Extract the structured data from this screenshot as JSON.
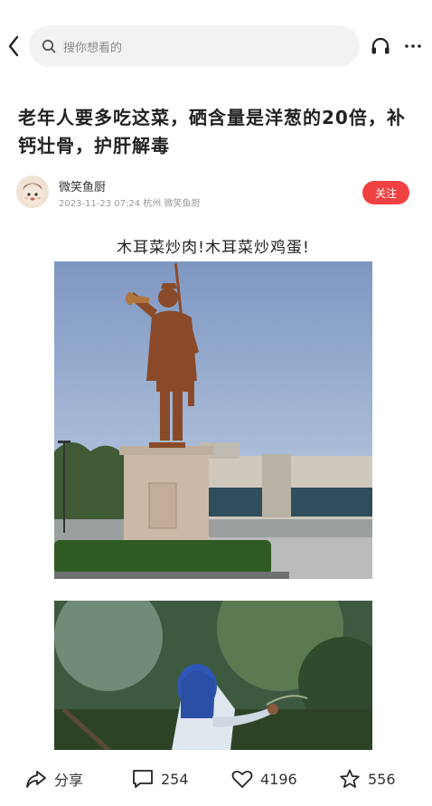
{
  "header": {
    "search_placeholder": "搜你想看的"
  },
  "article": {
    "title": "老年人要多吃这菜，硒含量是洋葱的20倍，补钙壮骨，护肝解毒",
    "author": {
      "name": "微笑鱼厨",
      "meta": "2023-11-23 07:24 杭州 微笑鱼厨",
      "follow_label": "关注"
    },
    "subtitle": "木耳菜炒肉!木耳菜炒鸡蛋!"
  },
  "bottom_bar": {
    "share_label": "分享",
    "comments": "254",
    "likes": "4196",
    "favorites": "556"
  },
  "colors": {
    "accent": "#f04142",
    "search_bg": "#f2f2f2"
  }
}
